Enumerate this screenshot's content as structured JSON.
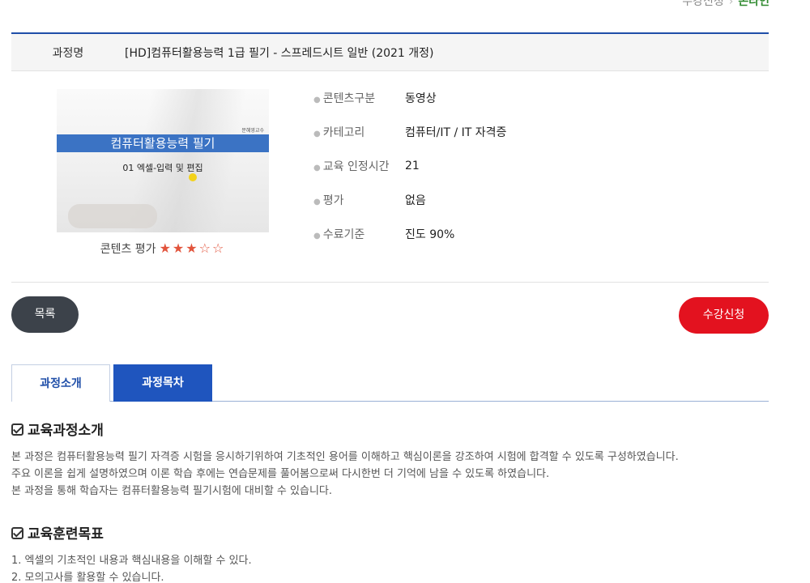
{
  "breadcrumb": {
    "parent": "수강신청",
    "current": "온라인"
  },
  "course": {
    "name_label": "과정명",
    "name": "[HD]컴퓨터활용능력 1급 필기 - 스프레드시트 일반 (2021 개정)"
  },
  "thumbnail": {
    "professor": "문혜영교수",
    "title": "컴퓨터활용능력 필기",
    "subtitle": "01 엑셀-입력 및 편집"
  },
  "rating": {
    "label": "콘텐츠 평가",
    "value": 3,
    "max": 5,
    "stars": "★★★☆☆"
  },
  "info": [
    {
      "key": "콘텐츠구분",
      "value": "동영상"
    },
    {
      "key": "카테고리",
      "value": "컴퓨터/IT / IT 자격증"
    },
    {
      "key": "교육 인정시간",
      "value": "21"
    },
    {
      "key": "평가",
      "value": "없음"
    },
    {
      "key": "수료기준",
      "value": "진도 90%"
    }
  ],
  "buttons": {
    "list": "목록",
    "apply": "수강신청"
  },
  "tabs": [
    {
      "label": "과정소개"
    },
    {
      "label": "과정목차"
    }
  ],
  "sections": {
    "intro": {
      "title": "교육과정소개",
      "lines": [
        "본 과정은 컴퓨터활용능력 필기 자격증 시험을 응시하기위하여 기초적인 용어를 이해하고 핵심이론을 강조하여 시험에 합격할 수 있도록 구성하였습니다.",
        "주요 이론을 쉽게 설명하였으며 이론 학습 후에는 연습문제를 풀어봄으로써 다시한번 더 기억에 남을 수 있도록 하였습니다.",
        "본 과정을 통해 학습자는 컴퓨터활용능력 필기시험에 대비할 수 있습니다."
      ]
    },
    "goals": {
      "title": "교육훈련목표",
      "lines": [
        "1. 엑셀의 기초적인 내용과 핵심내용을 이해할 수 있다.",
        "2. 모의고사를 활용할 수 있습니다."
      ]
    }
  },
  "colors": {
    "accent": "#1f55be",
    "apply": "#e3121f",
    "dark": "#3c424a",
    "star": "#e2543c"
  }
}
